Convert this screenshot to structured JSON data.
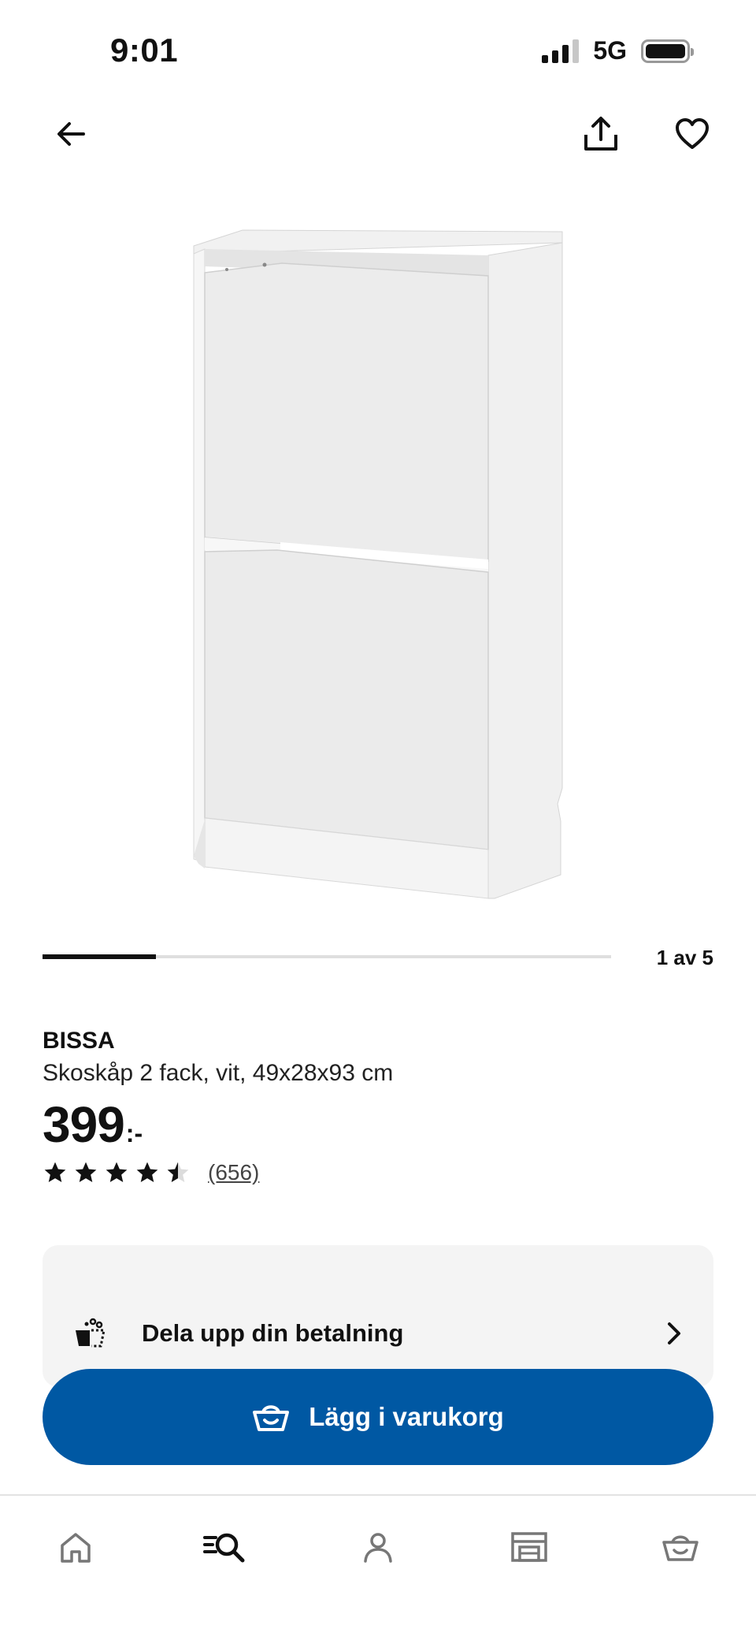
{
  "status_bar": {
    "time": "9:01",
    "network": "5G"
  },
  "top_nav": {
    "back_icon": "arrow-left-icon",
    "share_icon": "share-icon",
    "favorite_icon": "heart-icon"
  },
  "carousel": {
    "counter": "1 av 5",
    "current": 1,
    "total": 5
  },
  "product": {
    "brand": "BISSA",
    "description": "Skoskåp 2 fack, vit, 49x28x93 cm",
    "price": "399",
    "price_suffix": ":-",
    "rating_value": 4.5,
    "rating_max": 5,
    "review_count": "(656)"
  },
  "payment": {
    "label": "Dela upp din betalning",
    "icon": "split-payment-icon"
  },
  "cart_button": {
    "label": "Lägg i varukorg",
    "icon": "basket-icon"
  },
  "tab_bar": {
    "items": [
      {
        "icon": "home-icon",
        "active": false
      },
      {
        "icon": "search-icon",
        "active": true
      },
      {
        "icon": "profile-icon",
        "active": false
      },
      {
        "icon": "store-icon",
        "active": false
      },
      {
        "icon": "cart-icon",
        "active": false
      }
    ]
  },
  "colors": {
    "primary_blue": "#0058a3",
    "card_bg": "#f4f4f4",
    "text": "#111111"
  }
}
